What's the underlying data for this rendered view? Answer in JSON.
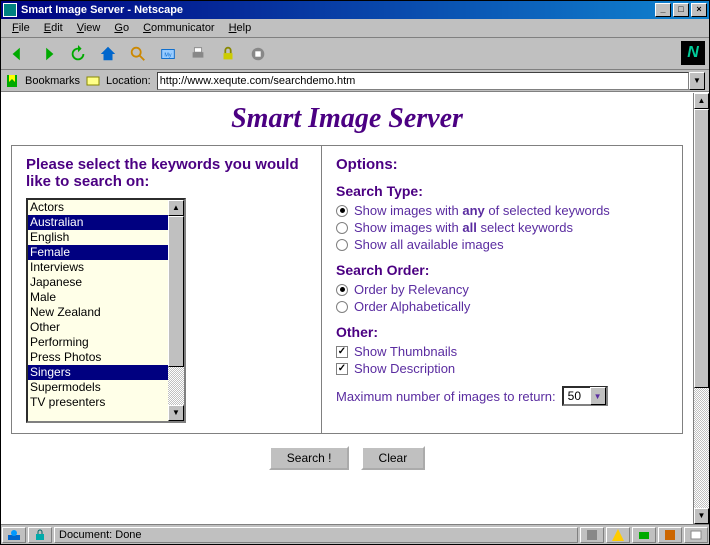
{
  "window": {
    "title": "Smart Image Server - Netscape"
  },
  "menu": {
    "items": [
      "File",
      "Edit",
      "View",
      "Go",
      "Communicator",
      "Help"
    ]
  },
  "location": {
    "bookmarks": "Bookmarks",
    "label": "Location:",
    "url": "http://www.xequte.com/searchdemo.htm"
  },
  "hero": "Smart Image Server",
  "left": {
    "heading": "Please select the keywords you would like to search on:",
    "items": [
      "Actors",
      "Australian",
      "English",
      "Female",
      "Interviews",
      "Japanese",
      "Male",
      "New Zealand",
      "Other",
      "Performing",
      "Press Photos",
      "Singers",
      "Supermodels",
      "TV presenters"
    ],
    "selected": [
      1,
      3,
      11
    ]
  },
  "right": {
    "options": "Options:",
    "searchTypeHead": "Search Type:",
    "searchType": {
      "any_pre": "Show images with ",
      "any_bold": "any",
      "any_post": " of selected keywords",
      "all_pre": "Show images with ",
      "all_bold": "all",
      "all_post": " select keywords",
      "allimg": "Show all available images",
      "selected": 0
    },
    "orderHead": "Search Order:",
    "order": {
      "relevancy": "Order by Relevancy",
      "alpha": "Order Alphabetically",
      "selected": 0
    },
    "otherHead": "Other:",
    "thumbs": {
      "label": "Show Thumbnails",
      "checked": true
    },
    "desc": {
      "label": "Show Description",
      "checked": true
    },
    "maxLabel": "Maximum number of images to return:",
    "maxValue": "50"
  },
  "buttons": {
    "search": "Search !",
    "clear": "Clear"
  },
  "status": {
    "text": "Document: Done"
  }
}
